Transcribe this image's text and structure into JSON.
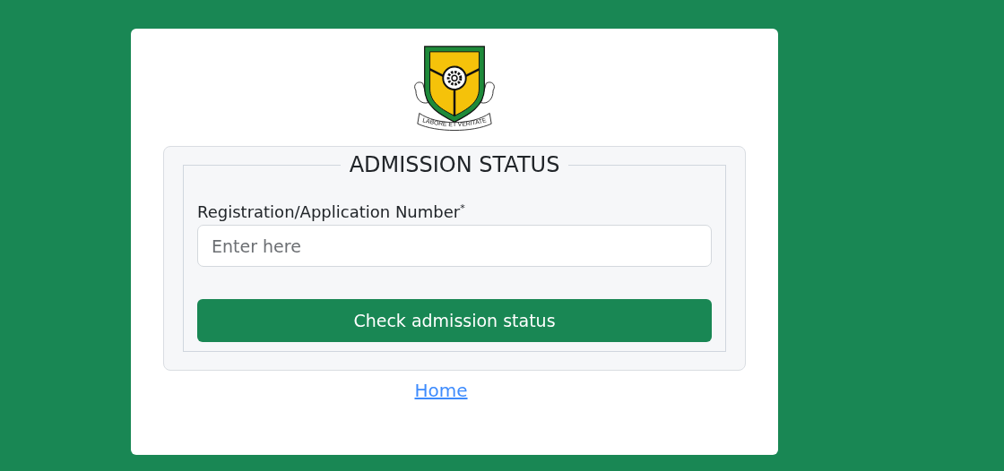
{
  "logo": {
    "motto": "LABORE ET VERITATE"
  },
  "form": {
    "legend": "ADMISSION STATUS",
    "field_label": "Registration/Application Number$^{*}$",
    "placeholder": "Enter here",
    "button": "Check admission status"
  },
  "link": "Home"
}
